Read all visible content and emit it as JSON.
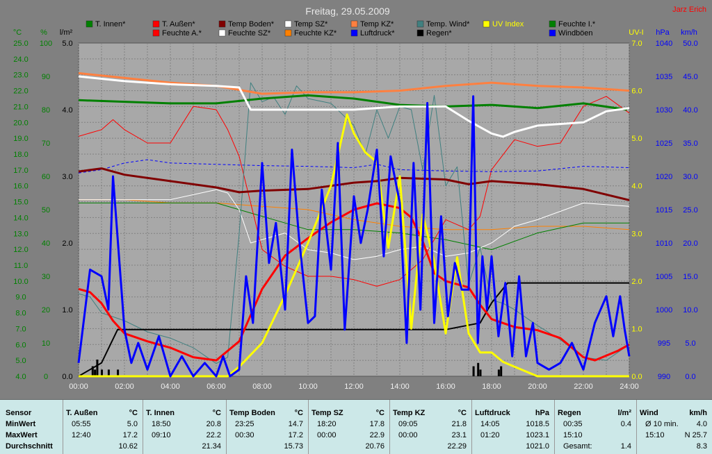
{
  "header": {
    "title": "Freitag, 29.05.2009",
    "author": "Jarz Erich"
  },
  "legend": [
    {
      "label": "T. Innen*",
      "color": "#008000"
    },
    {
      "label": "T. Außen*",
      "color": "#ff0000"
    },
    {
      "label": "Temp Boden*",
      "color": "#800000"
    },
    {
      "label": "Temp SZ*",
      "color": "#ffffff"
    },
    {
      "label": "Temp KZ*",
      "color": "#ff8040"
    },
    {
      "label": "Temp. Wind*",
      "color": "#408080"
    },
    {
      "label": "UV Index",
      "color": "#ffff00"
    },
    {
      "label": "Feuchte I.*",
      "color": "#008000"
    },
    {
      "label": "Feuchte A.*",
      "color": "#ff0000"
    },
    {
      "label": "Feuchte SZ*",
      "color": "#ffffff"
    },
    {
      "label": "Feuchte KZ*",
      "color": "#ff8000"
    },
    {
      "label": "Luftdruck*",
      "color": "#0000ff"
    },
    {
      "label": "Regen*",
      "color": "#000000"
    },
    {
      "label": "Windböen",
      "color": "#0000ff"
    }
  ],
  "chart_data": {
    "type": "line",
    "title": "Freitag, 29.05.2009",
    "grid": true,
    "xlim": [
      "00:00",
      "24:00"
    ],
    "x_ticks": [
      "00:00",
      "02:00",
      "04:00",
      "06:00",
      "08:00",
      "10:00",
      "12:00",
      "14:00",
      "16:00",
      "18:00",
      "20:00",
      "22:00",
      "24:00"
    ],
    "axes": [
      {
        "name": "°C",
        "color": "#008000",
        "range": [
          4.0,
          25.0
        ],
        "ticks": [
          "25.0",
          "24.0",
          "23.0",
          "22.0",
          "21.0",
          "20.0",
          "19.0",
          "18.0",
          "17.0",
          "16.0",
          "15.0",
          "14.0",
          "13.0",
          "12.0",
          "11.0",
          "10.0",
          "9.0",
          "8.0",
          "7.0",
          "6.0",
          "5.0",
          "4.0"
        ]
      },
      {
        "name": "%",
        "color": "#008000",
        "range": [
          0,
          100
        ],
        "ticks": [
          "100",
          "90",
          "80",
          "70",
          "60",
          "50",
          "40",
          "30",
          "20",
          "10",
          "0"
        ]
      },
      {
        "name": "l/m²",
        "color": "#000000",
        "range": [
          0.0,
          5.0
        ],
        "ticks": [
          "5.0",
          "4.0",
          "3.0",
          "2.0",
          "1.0",
          "0.0"
        ]
      },
      {
        "name": "UV-I",
        "color": "#ffff00",
        "range": [
          0.0,
          7.0
        ],
        "ticks": [
          "7.0",
          "6.0",
          "5.0",
          "4.0",
          "3.0",
          "2.0",
          "1.0",
          "0.0"
        ]
      },
      {
        "name": "hPa",
        "color": "#0000ff",
        "range": [
          990,
          1040
        ],
        "ticks": [
          "1040",
          "1035",
          "1030",
          "1025",
          "1020",
          "1015",
          "1010",
          "1005",
          "1000",
          "995",
          "990"
        ]
      },
      {
        "name": "km/h",
        "color": "#0000ff",
        "range": [
          0.0,
          50.0
        ],
        "ticks": [
          "50.0",
          "45.0",
          "40.0",
          "35.0",
          "30.0",
          "25.0",
          "20.0",
          "15.0",
          "10.0",
          "5.0",
          "0.0"
        ]
      }
    ],
    "series": [
      {
        "name": "T. Innen*",
        "axis": "°C",
        "color": "#008000",
        "width": 3,
        "x": [
          0,
          2,
          4,
          6,
          8,
          10,
          12,
          14,
          16,
          18,
          20,
          22,
          23.9
        ],
        "y": [
          21.4,
          21.3,
          21.2,
          21.2,
          21.5,
          21.7,
          21.5,
          21.1,
          21.0,
          21.1,
          20.9,
          21.2,
          20.8
        ]
      },
      {
        "name": "T. Außen*",
        "axis": "°C",
        "color": "#ff0000",
        "width": 3,
        "x": [
          0,
          0.5,
          1,
          1.5,
          2,
          3,
          4,
          5,
          6,
          7,
          8,
          9,
          10,
          11,
          12,
          13,
          14,
          14.5,
          15,
          15.5,
          16,
          17,
          17.5,
          18,
          19,
          20,
          21,
          22,
          22.5,
          23,
          23.5,
          24
        ],
        "y": [
          9.5,
          9.3,
          8.6,
          7.5,
          6.7,
          6.2,
          5.8,
          5.2,
          5.0,
          6.2,
          9.5,
          11.6,
          12.7,
          13.7,
          14.5,
          14.9,
          14.6,
          14.0,
          12.5,
          10.5,
          10.0,
          9.6,
          8.5,
          7.6,
          7.1,
          6.9,
          6.4,
          5.2,
          5.0,
          5.3,
          5.6,
          6.0
        ]
      },
      {
        "name": "Temp Boden*",
        "axis": "°C",
        "color": "#800000",
        "width": 3,
        "x": [
          0,
          1,
          2,
          4,
          6,
          7,
          8,
          10,
          12,
          13,
          14,
          16,
          17,
          18,
          20,
          22,
          24
        ],
        "y": [
          16.9,
          17.1,
          16.7,
          16.3,
          15.9,
          15.6,
          15.7,
          15.8,
          16.2,
          16.3,
          16.5,
          16.4,
          16.1,
          16.3,
          16.1,
          15.8,
          15.1
        ]
      },
      {
        "name": "Temp SZ*",
        "axis": "°C",
        "color": "#ffffff",
        "width": 3,
        "x": [
          0,
          2,
          4,
          6,
          7,
          7.5,
          8,
          10,
          12,
          14,
          16,
          17,
          18,
          18.5,
          19,
          20,
          22,
          23,
          24
        ],
        "y": [
          22.9,
          22.6,
          22.4,
          22.3,
          22.2,
          20.8,
          20.8,
          20.8,
          20.8,
          21.0,
          21.0,
          20.1,
          19.3,
          19.1,
          19.4,
          19.8,
          20.0,
          20.7,
          20.9
        ]
      },
      {
        "name": "Temp KZ*",
        "axis": "°C",
        "color": "#ff8040",
        "width": 3,
        "x": [
          0,
          2,
          4,
          6,
          8,
          10,
          12,
          14,
          16,
          18,
          20,
          22,
          24
        ],
        "y": [
          23.1,
          22.8,
          22.5,
          22.3,
          21.8,
          21.9,
          21.9,
          22.0,
          22.3,
          22.5,
          22.3,
          22.2,
          22.0
        ]
      },
      {
        "name": "Regen*",
        "axis": "l/m²",
        "color": "#000000",
        "width": 2,
        "x": [
          0,
          1,
          1.7,
          2,
          6,
          8,
          12,
          16,
          17.5,
          18,
          18.7,
          20,
          22,
          24
        ],
        "y": [
          0,
          0.2,
          0.7,
          0.7,
          0.7,
          0.7,
          0.7,
          0.7,
          0.8,
          1.1,
          1.4,
          1.4,
          1.4,
          1.4
        ]
      },
      {
        "name": "UV Index",
        "axis": "UV-I",
        "color": "#ffff00",
        "width": 3,
        "x": [
          0,
          6.5,
          7,
          8,
          9,
          10,
          11,
          11.7,
          12,
          12.5,
          13,
          13.5,
          14,
          14.5,
          15,
          15.5,
          16,
          16.5,
          17,
          17.5,
          18,
          18.5,
          19,
          20,
          24
        ],
        "y": [
          0,
          0,
          0.2,
          0.7,
          1.7,
          2.8,
          4.0,
          5.5,
          5.1,
          4.7,
          4.5,
          2.7,
          4.2,
          1.0,
          3.4,
          2.4,
          0.9,
          2.5,
          0.9,
          0.5,
          0.5,
          0.3,
          0.2,
          0,
          0
        ]
      },
      {
        "name": "Feuchte I.*",
        "axis": "%",
        "color": "#008000",
        "width": 1,
        "x": [
          0,
          2,
          4,
          6,
          8,
          10,
          12,
          14,
          16,
          18,
          20,
          22,
          24
        ],
        "y": [
          52,
          52,
          52,
          52,
          48,
          44,
          44,
          43,
          41,
          38,
          43,
          46,
          46
        ]
      },
      {
        "name": "Feuchte A.*",
        "axis": "%",
        "color": "#ff0000",
        "width": 1,
        "x": [
          0,
          1,
          1.5,
          2,
          3,
          4,
          5,
          6,
          6.5,
          7,
          7.5,
          8,
          9,
          10,
          11,
          12,
          13,
          14,
          15,
          16,
          17,
          17.5,
          18,
          19,
          20,
          21,
          22,
          23,
          24
        ],
        "y": [
          72,
          74,
          77,
          74,
          70,
          70,
          81,
          80,
          74,
          66,
          52,
          38,
          33,
          30,
          30,
          29,
          27,
          29,
          35,
          47,
          44,
          48,
          62,
          71,
          69,
          70,
          81,
          84,
          79
        ]
      },
      {
        "name": "Feuchte SZ*",
        "axis": "%",
        "color": "#ffffff",
        "width": 1,
        "x": [
          0,
          2,
          4,
          6,
          6.5,
          7,
          7.5,
          8,
          9,
          10,
          11,
          12,
          13,
          14,
          15,
          16,
          17,
          18,
          19,
          20,
          22,
          24
        ],
        "y": [
          53,
          53,
          53,
          56,
          55,
          50,
          40,
          41,
          43,
          38,
          37,
          35,
          36,
          38,
          39,
          36,
          37,
          40,
          45,
          47,
          52,
          51
        ]
      },
      {
        "name": "Feuchte KZ*",
        "axis": "%",
        "color": "#ff8000",
        "width": 1,
        "x": [
          0,
          2,
          4,
          6,
          8,
          10,
          12,
          14,
          16,
          18,
          20,
          22,
          24
        ],
        "y": [
          53,
          53,
          52,
          52,
          51,
          50,
          47,
          45,
          44,
          44,
          45,
          45,
          44
        ]
      },
      {
        "name": "Luftdruck*",
        "axis": "hPa",
        "color": "#0000ff",
        "width": 1,
        "dashed": true,
        "x": [
          0,
          1,
          2,
          3,
          4,
          6,
          8,
          10,
          12,
          13,
          14,
          16,
          18,
          20,
          22,
          24
        ],
        "y": [
          1020.5,
          1021.0,
          1022.0,
          1022.5,
          1022.0,
          1021.8,
          1021.6,
          1021.5,
          1021.3,
          1021.8,
          1021.0,
          1020.8,
          1020.7,
          1020.8,
          1021.5,
          1021.3
        ]
      },
      {
        "name": "Temp. Wind*",
        "axis": "°C",
        "color": "#408080",
        "width": 1,
        "x": [
          0,
          0.5,
          1,
          2,
          3,
          4,
          5,
          6,
          6.5,
          7,
          7.5,
          8,
          8.5,
          9,
          9.5,
          10,
          11,
          12,
          12.5,
          13,
          13.5,
          14,
          14.5,
          15,
          15.5,
          16,
          16.5,
          17,
          17.5,
          18,
          18.5,
          19,
          20,
          21,
          22,
          23,
          24
        ],
        "y": [
          9.2,
          9.0,
          8.0,
          7.5,
          6.8,
          6.4,
          5.8,
          4.8,
          5.2,
          13.0,
          22.5,
          21.3,
          21.6,
          20.5,
          22.3,
          21.5,
          21.2,
          19.8,
          18.0,
          20.8,
          19.0,
          21.0,
          20.8,
          17.0,
          21.7,
          16.0,
          17.2,
          9.8,
          12.1,
          8.8,
          8.6,
          8.2,
          7.2,
          6.3,
          5.2,
          5.0,
          6.0
        ]
      },
      {
        "name": "Windböen",
        "axis": "km/h",
        "color": "#0000ff",
        "width": 3,
        "x": [
          0,
          0.5,
          1,
          1.3,
          1.5,
          2,
          2.3,
          2.6,
          3,
          3.5,
          4,
          4.5,
          5,
          5.5,
          6,
          6.3,
          6.6,
          7,
          7.3,
          7.6,
          8,
          8.3,
          8.6,
          9,
          9.3,
          9.6,
          10,
          10.3,
          10.6,
          11,
          11.3,
          11.6,
          12,
          12.3,
          12.6,
          13,
          13.3,
          13.6,
          14,
          14.3,
          14.6,
          14.9,
          15.2,
          15.5,
          15.8,
          16.1,
          16.4,
          16.7,
          17,
          17.2,
          17.4,
          17.6,
          17.8,
          18,
          18.3,
          18.6,
          18.9,
          19.2,
          19.5,
          19.8,
          20,
          20.5,
          21,
          21.5,
          22,
          22.5,
          23,
          23.3,
          23.6,
          23.8,
          24
        ],
        "y": [
          2,
          16,
          15,
          10,
          30,
          7,
          2,
          5,
          1,
          6,
          0,
          3,
          0,
          2,
          0,
          3,
          0,
          1,
          15,
          8,
          32,
          17,
          23,
          10,
          34,
          21,
          8,
          9,
          28,
          16,
          35,
          7,
          27,
          20,
          25,
          34,
          18,
          33,
          26,
          5,
          32,
          10,
          41,
          8,
          24,
          9,
          17,
          13,
          13,
          42,
          5,
          18,
          10,
          18,
          6,
          14,
          3,
          15,
          3,
          8,
          2,
          1,
          2,
          5,
          1,
          8,
          12,
          6,
          12,
          7,
          3
        ]
      }
    ]
  },
  "stats": [
    {
      "sensor": "T. Außen",
      "unit": "°C",
      "min_time": "05:55",
      "min_val": "5.0",
      "max_time": "12:40",
      "max_val": "17.2",
      "avg_val": "10.62"
    },
    {
      "sensor": "T. Innen",
      "unit": "°C",
      "min_time": "18:50",
      "min_val": "20.8",
      "max_time": "09:10",
      "max_val": "22.2",
      "avg_val": "21.34"
    },
    {
      "sensor": "Temp Boden",
      "unit": "°C",
      "min_time": "23:25",
      "min_val": "14.7",
      "max_time": "00:30",
      "max_val": "17.2",
      "avg_val": "15.73"
    },
    {
      "sensor": "Temp SZ",
      "unit": "°C",
      "min_time": "18:20",
      "min_val": "17.8",
      "max_time": "00:00",
      "max_val": "22.9",
      "avg_val": "20.76"
    },
    {
      "sensor": "Temp KZ",
      "unit": "°C",
      "min_time": "09:05",
      "min_val": "21.8",
      "max_time": "00:00",
      "max_val": "23.1",
      "avg_val": "22.29"
    },
    {
      "sensor": "Luftdruck",
      "unit": "hPa",
      "min_time": "14:05",
      "min_val": "1018.5",
      "max_time": "01:20",
      "max_val": "1023.1",
      "avg_val": "1021.0"
    },
    {
      "sensor": "Regen",
      "unit": "l/m²",
      "min_time": "00:35",
      "min_val": "0.4",
      "max_time": "15:10",
      "max_val": "",
      "avg_time": "Gesamt:",
      "avg_val": "1.4"
    },
    {
      "sensor": "Wind",
      "unit": "km/h",
      "min_time": "Ø 10 min.",
      "min_val": "4.0",
      "max_time": "15:10",
      "max_val": "N 25.7",
      "avg_val": "8.3"
    }
  ],
  "stats_labels": {
    "sensor": "Sensor",
    "min": "MinWert",
    "max": "MaxWert",
    "avg": "Durchschnitt"
  }
}
